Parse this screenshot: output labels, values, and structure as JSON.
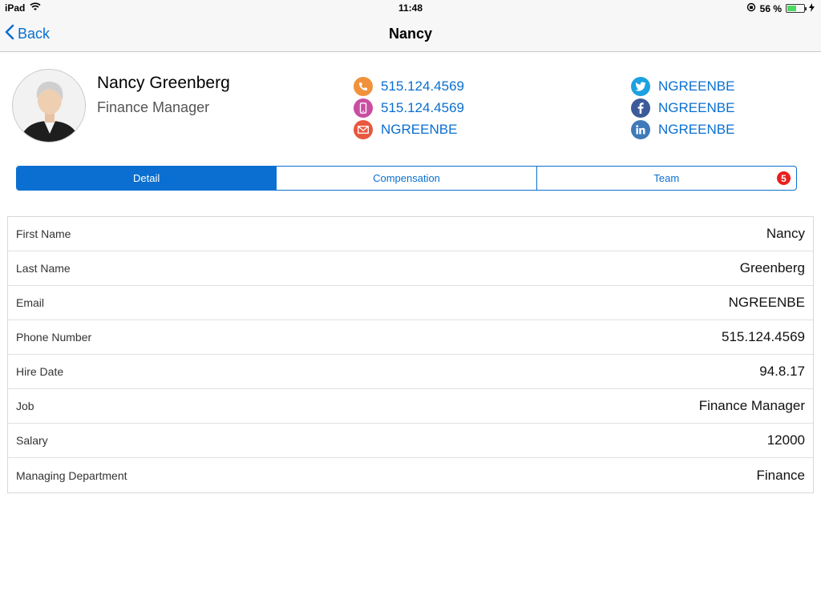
{
  "status_bar": {
    "device": "iPad",
    "time": "11:48",
    "battery": "56 %",
    "battery_level": 0.56
  },
  "nav": {
    "back_label": "Back",
    "title": "Nancy"
  },
  "profile": {
    "name": "Nancy Greenberg",
    "title": "Finance Manager",
    "contacts_left": [
      {
        "icon": "phone-icon",
        "color": "#f0923b",
        "value": "515.124.4569"
      },
      {
        "icon": "mobile-icon",
        "color": "#c94ea2",
        "value": "515.124.4569"
      },
      {
        "icon": "email-icon",
        "color": "#e8583f",
        "value": "NGREENBE"
      }
    ],
    "contacts_right": [
      {
        "icon": "twitter-icon",
        "color": "#1da1e1",
        "value": "NGREENBE"
      },
      {
        "icon": "facebook-icon",
        "color": "#3d5b99",
        "value": "NGREENBE"
      },
      {
        "icon": "linkedin-icon",
        "color": "#3f7ab8",
        "value": "NGREENBE"
      }
    ]
  },
  "tabs": [
    {
      "label": "Detail",
      "active": true
    },
    {
      "label": "Compensation",
      "active": false
    },
    {
      "label": "Team",
      "active": false,
      "badge": "5"
    }
  ],
  "details": [
    {
      "label": "First Name",
      "value": "Nancy"
    },
    {
      "label": "Last Name",
      "value": "Greenberg"
    },
    {
      "label": "Email",
      "value": "NGREENBE"
    },
    {
      "label": "Phone Number",
      "value": "515.124.4569"
    },
    {
      "label": "Hire Date",
      "value": "94.8.17"
    },
    {
      "label": "Job",
      "value": "Finance Manager"
    },
    {
      "label": "Salary",
      "value": "12000"
    },
    {
      "label": "Managing Department",
      "value": "Finance"
    }
  ],
  "colors": {
    "accent": "#0a6fd0",
    "badge": "#e8201f"
  }
}
